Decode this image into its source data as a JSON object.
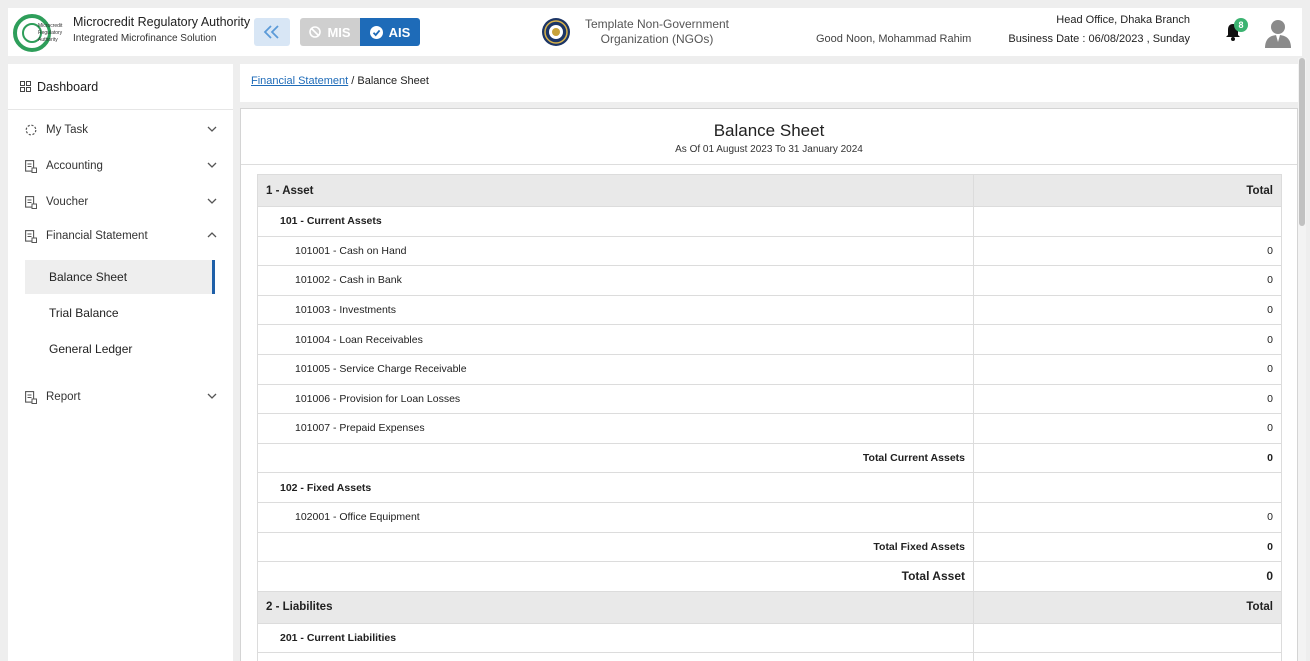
{
  "header": {
    "org_name": "Microcredit Regulatory Authority",
    "org_sub": "Integrated Microfinance Solution",
    "logo_text_1": "Microcredit",
    "logo_text_2": "Regulatory",
    "logo_text_3": "Authority",
    "mis_label": "MIS",
    "ais_label": "AIS",
    "ngo_line1": "Template Non-Government",
    "ngo_line2": "Organization (NGOs)",
    "greeting": "Good Noon, Mohammad Rahim",
    "branch": "Head Office, Dhaka Branch",
    "business_date": "Business Date : 06/08/2023 , Sunday",
    "notification_count": "8",
    "colors": {
      "accent": "#1e6bb8",
      "badge": "#3cb371",
      "logo_green": "#2e9e5a"
    }
  },
  "sidebar": {
    "dashboard": "Dashboard",
    "items": [
      {
        "label": "My Task"
      },
      {
        "label": "Accounting"
      },
      {
        "label": "Voucher"
      },
      {
        "label": "Financial Statement"
      },
      {
        "label": "Report"
      }
    ],
    "sub_items": [
      {
        "label": "Balance Sheet",
        "active": true
      },
      {
        "label": "Trial Balance",
        "active": false
      },
      {
        "label": "General Ledger",
        "active": false
      }
    ]
  },
  "breadcrumb": {
    "parent": "Financial Statement",
    "separator": "/",
    "current": "Balance Sheet"
  },
  "report": {
    "title": "Balance Sheet",
    "subtitle": "As Of 01 August 2023 To 31 January 2024",
    "rows": [
      {
        "type": "head",
        "label": "1 - Asset",
        "value": "Total"
      },
      {
        "type": "sub",
        "label": "101 - Current Assets",
        "value": ""
      },
      {
        "type": "acc",
        "label": "101001 - Cash on Hand",
        "value": "0"
      },
      {
        "type": "acc",
        "label": "101002 - Cash in Bank",
        "value": "0"
      },
      {
        "type": "acc",
        "label": "101003 - Investments",
        "value": "0"
      },
      {
        "type": "acc",
        "label": "101004 - Loan Receivables",
        "value": "0"
      },
      {
        "type": "acc",
        "label": "101005 - Service Charge Receivable",
        "value": "0"
      },
      {
        "type": "acc",
        "label": "101006 - Provision for Loan Losses",
        "value": "0"
      },
      {
        "type": "acc",
        "label": "101007 - Prepaid Expenses",
        "value": "0"
      },
      {
        "type": "tot",
        "label": "Total Current Assets",
        "value": "0"
      },
      {
        "type": "sub",
        "label": "102 - Fixed Assets",
        "value": ""
      },
      {
        "type": "acc",
        "label": "102001 - Office Equipment",
        "value": "0"
      },
      {
        "type": "tot",
        "label": "Total Fixed Assets",
        "value": "0"
      },
      {
        "type": "grand",
        "label": "Total Asset",
        "value": "0"
      },
      {
        "type": "head",
        "label": "2 - Liabilites",
        "value": "Total"
      },
      {
        "type": "sub",
        "label": "201 - Current Liabilities",
        "value": ""
      },
      {
        "type": "acc",
        "label": "",
        "value": ""
      }
    ]
  }
}
